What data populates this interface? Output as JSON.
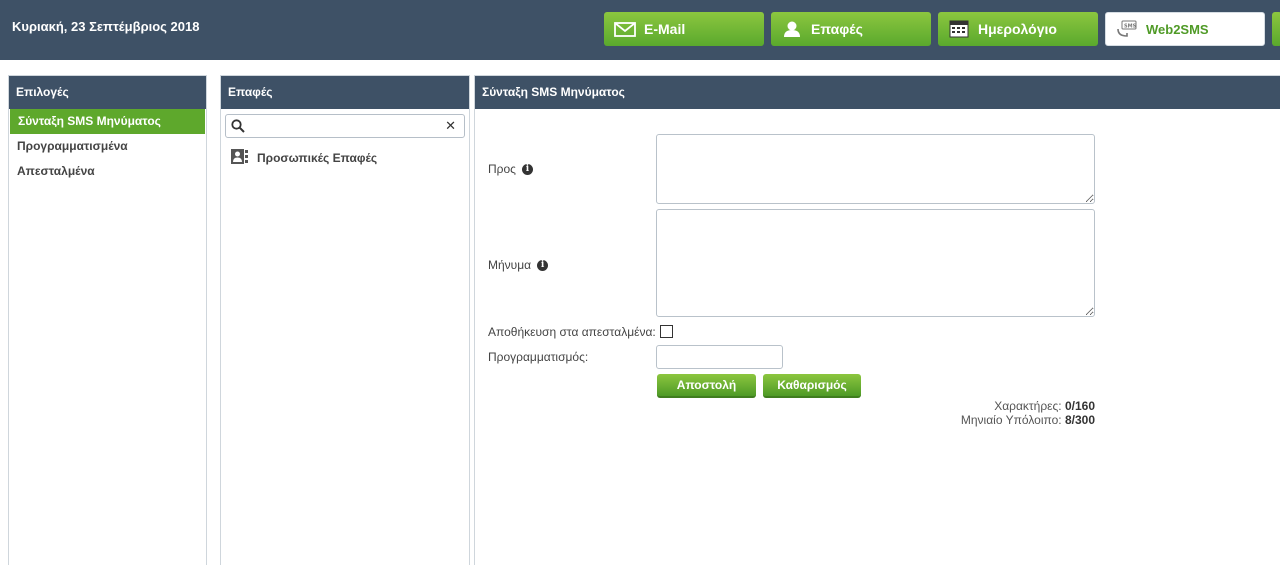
{
  "header": {
    "date": "Κυριακή, 23 Σεπτέμβριος 2018",
    "nav": [
      {
        "label": "E-Mail",
        "icon": "envelope-icon"
      },
      {
        "label": "Επαφές",
        "icon": "contact-person-icon"
      },
      {
        "label": "Ημερολόγιο",
        "icon": "calendar-icon"
      },
      {
        "label": "Web2SMS",
        "icon": "sms-icon",
        "active": true
      }
    ]
  },
  "options": {
    "title": "Επιλογές",
    "items": [
      {
        "label": "Σύνταξη SMS Μηνύματος",
        "selected": true
      },
      {
        "label": "Προγραμματισμένα"
      },
      {
        "label": "Απεσταλμένα"
      }
    ]
  },
  "contacts": {
    "title": "Επαφές",
    "search": {
      "value": "",
      "placeholder": ""
    },
    "groups": [
      {
        "label": "Προσωπικές Επαφές"
      }
    ]
  },
  "compose": {
    "title": "Σύνταξη SMS Μηνύματος",
    "to_label": "Προς",
    "message_label": "Μήνυμα",
    "save_label": "Αποθήκευση στα απεσταλμένα:",
    "save_checked": false,
    "schedule_label": "Προγραμματισμός:",
    "send_button": "Αποστολή",
    "clear_button": "Καθαρισμός",
    "chars_label": "Χαρακτήρες:",
    "chars_value": "0/160",
    "balance_label": "Μηνιαίο Υπόλοιπο:",
    "balance_value": "8/300"
  },
  "colors": {
    "header_bg": "#3e5166",
    "accent_green": "#5ea82c"
  }
}
